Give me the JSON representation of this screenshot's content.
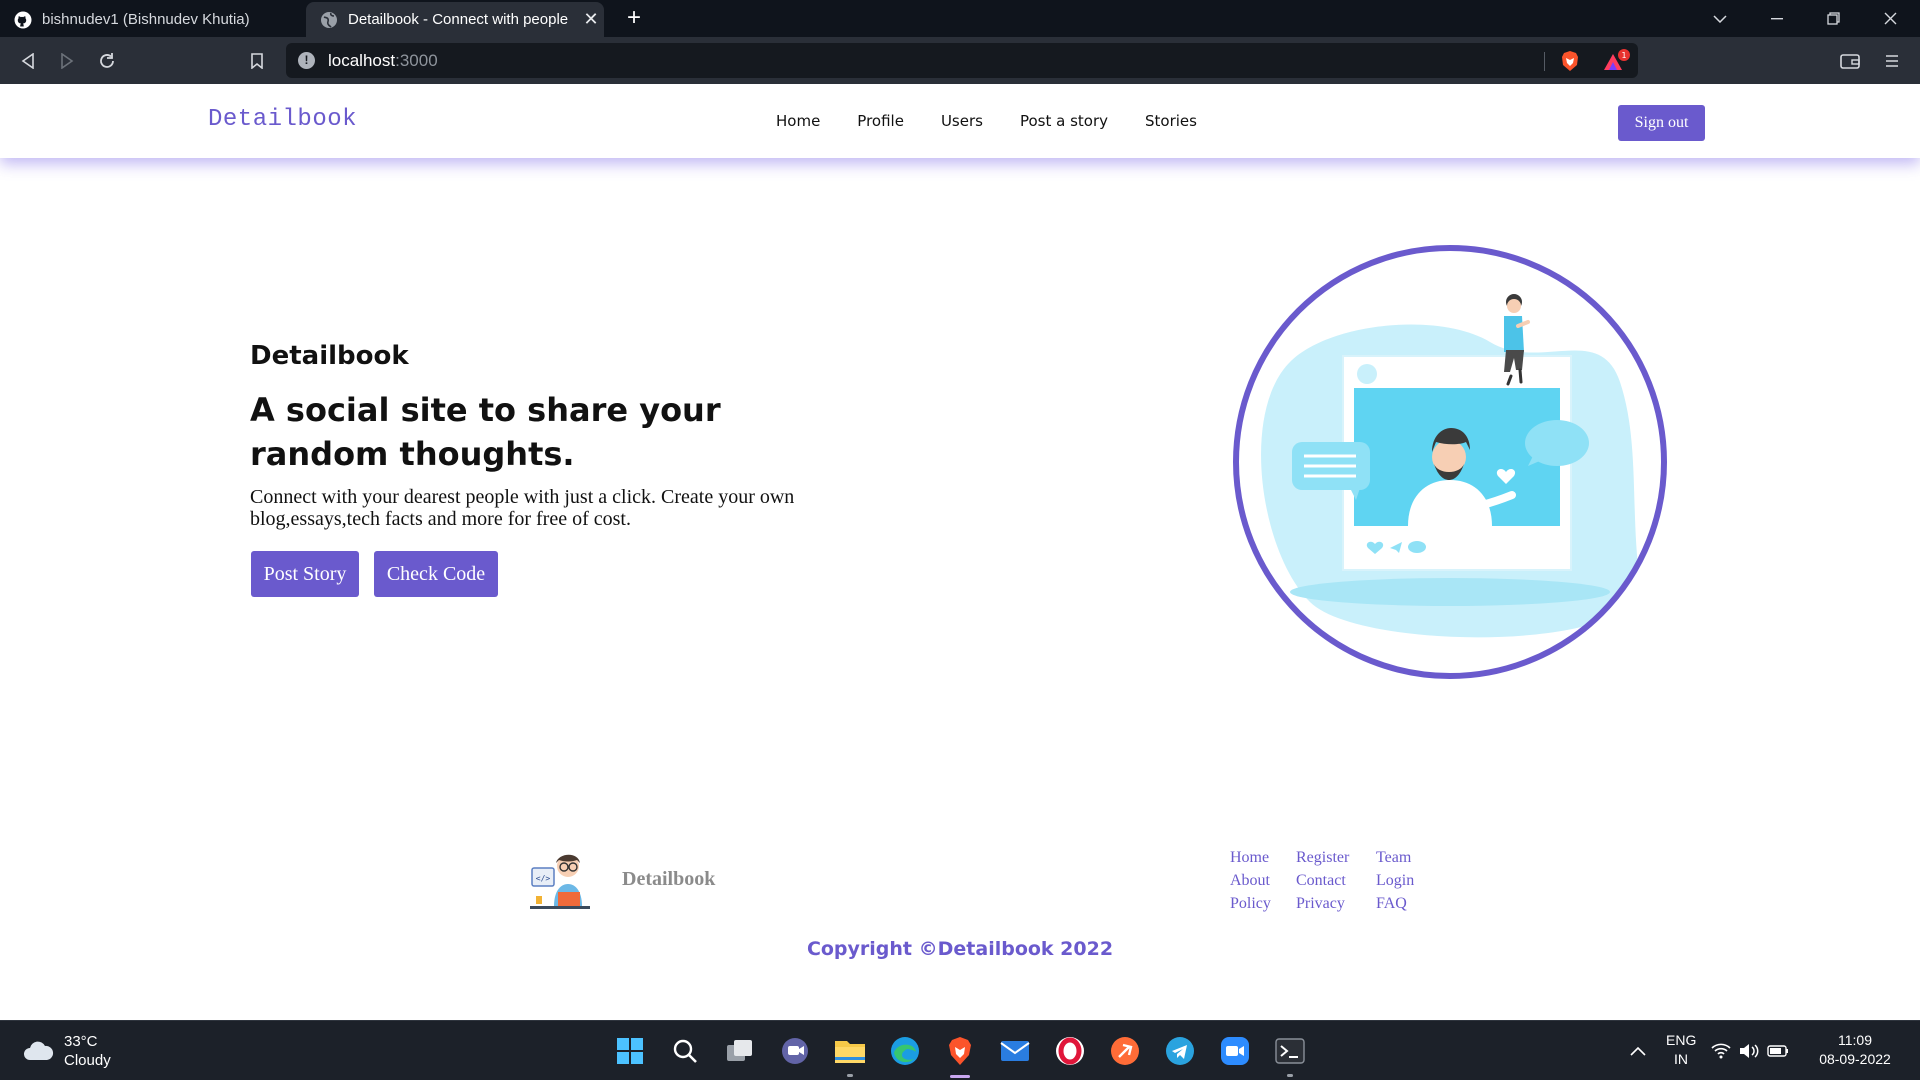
{
  "browser": {
    "tabs": [
      {
        "title": "bishnudev1 (Bishnudev Khutia)",
        "icon": "github-icon",
        "active": false
      },
      {
        "title": "Detailbook - Connect with people",
        "icon": "globe-icon",
        "active": true
      }
    ],
    "address": {
      "host": "localhost",
      "port": ":3000"
    }
  },
  "site": {
    "brand": "Detailbook",
    "nav": [
      "Home",
      "Profile",
      "Users",
      "Post a story",
      "Stories"
    ],
    "sign_out": "Sign out",
    "accent_color": "#6a5acd"
  },
  "hero": {
    "kicker": "Detailbook",
    "title": "A social site to share your random thoughts.",
    "description": "Connect with your dearest people with just a click. Create your own blog,essays,tech facts and more for free of cost.",
    "buttons": {
      "post": "Post Story",
      "code": "Check Code"
    }
  },
  "footer": {
    "brand": "Detailbook",
    "links": [
      "Home",
      "Register",
      "Team",
      "About",
      "Contact",
      "Login",
      "Policy",
      "Privacy",
      "FAQ"
    ],
    "copyright": "Copyright ©Detailbook 2022"
  },
  "taskbar": {
    "weather": {
      "temp": "33°C",
      "condition": "Cloudy"
    },
    "apps": [
      "windows-start-icon",
      "search-icon",
      "task-view-icon",
      "teams-chat-icon",
      "file-explorer-icon",
      "edge-icon",
      "brave-icon",
      "mail-icon",
      "opera-icon",
      "postman-icon",
      "telegram-icon",
      "zoom-icon",
      "terminal-icon"
    ],
    "language": {
      "line1": "ENG",
      "line2": "IN"
    },
    "clock": {
      "time": "11:09",
      "date": "08-09-2022"
    }
  }
}
